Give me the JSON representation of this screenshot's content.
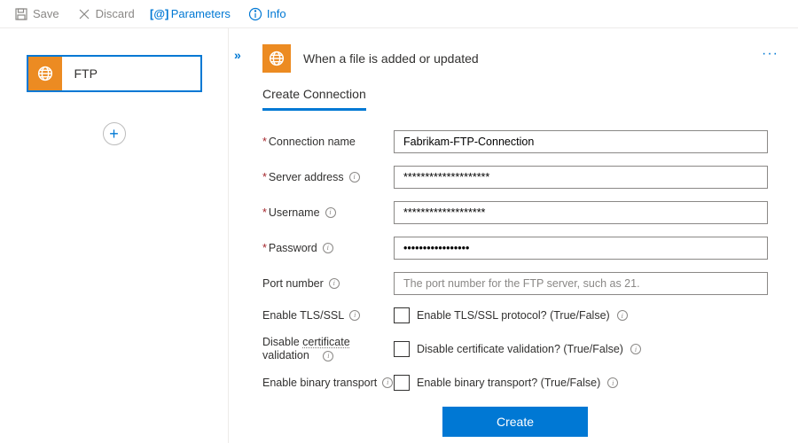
{
  "toolbar": {
    "save": "Save",
    "discard": "Discard",
    "parameters": "Parameters",
    "info": "Info"
  },
  "sidebar": {
    "step_label": "FTP"
  },
  "panel": {
    "header_title": "When a file is added or updated",
    "tab_label": "Create Connection",
    "more": "···",
    "collapse": "»",
    "fields": {
      "conn_name": {
        "label": "Connection name",
        "value": "Fabrikam-FTP-Connection"
      },
      "server": {
        "label": "Server address",
        "value": "********************"
      },
      "username": {
        "label": "Username",
        "value": "*******************"
      },
      "password": {
        "label": "Password",
        "value": "•••••••••••••••••"
      },
      "port": {
        "label": "Port number",
        "placeholder": "The port number for the FTP server, such as 21."
      },
      "tls": {
        "label": "Enable TLS/SSL",
        "check_label": "Enable TLS/SSL protocol? (True/False)"
      },
      "cert": {
        "label_line1": "Disable ",
        "label_underlined": "certificate",
        "label_line2": "validation",
        "check_label": "Disable certificate validation? (True/False)"
      },
      "binary": {
        "label": "Enable binary transport",
        "check_label": "Enable binary transport? (True/False)"
      }
    },
    "create_btn": "Create"
  }
}
